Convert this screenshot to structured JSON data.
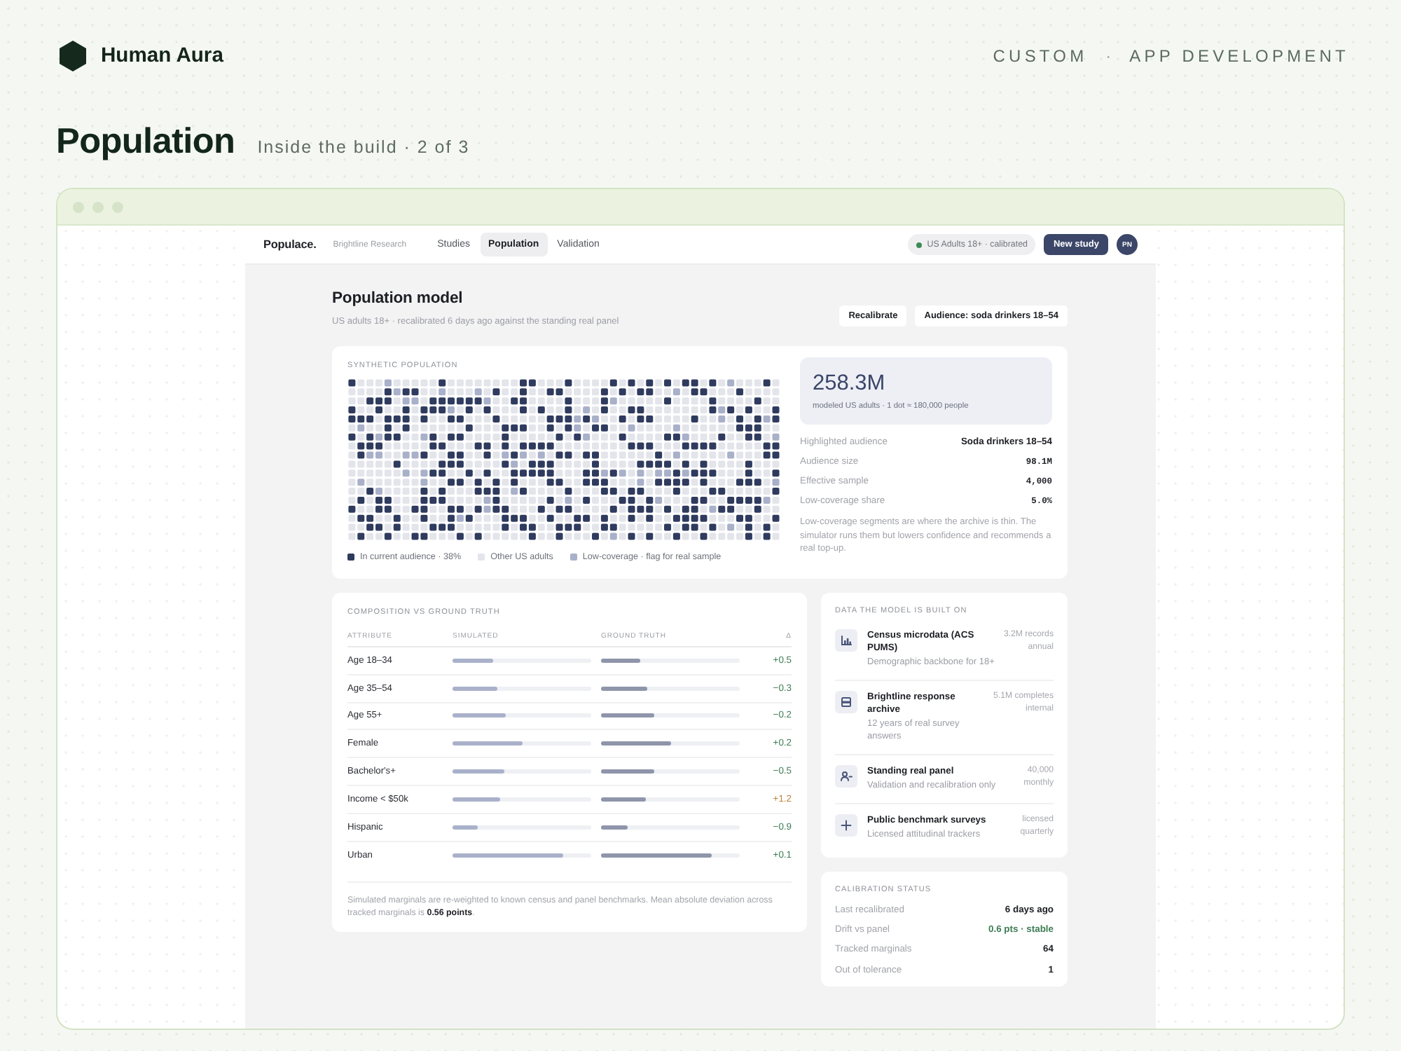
{
  "header": {
    "brand": "Human Aura",
    "links": [
      {
        "label": "CUSTOM"
      },
      {
        "label": "APP DEVELOPMENT"
      }
    ],
    "separator": "·"
  },
  "page": {
    "title": "Population",
    "subtitle": "Inside the build · 2 of 3"
  },
  "app": {
    "brand": "Populace.",
    "organization": "Brightline Research",
    "tabs": [
      {
        "label": "Studies",
        "selected": false
      },
      {
        "label": "Population",
        "selected": true
      },
      {
        "label": "Validation",
        "selected": false
      }
    ],
    "status_pill": "US Adults 18+ · calibrated",
    "primary_button": "New study",
    "avatar": "PN"
  },
  "model": {
    "title": "Population model",
    "subtitle": "US adults 18+ · recalibrated 6 days ago against the standing real panel",
    "buttons": [
      {
        "label": "Recalibrate"
      },
      {
        "label": "Audience: soda drinkers 18–54"
      }
    ]
  },
  "synthetic_population": {
    "heading": "SYNTHETIC POPULATION",
    "legend": [
      {
        "label": "In current audience · 38%",
        "color": "#2f3b5e"
      },
      {
        "label": "Other US adults",
        "color": "#e3e5eb"
      },
      {
        "label": "Low-coverage · flag for real sample",
        "color": "#a9b0c9"
      }
    ],
    "total": "258.3M",
    "total_caption": "modeled US adults · 1 dot ≈ 180,000 people",
    "facts": [
      {
        "label": "Highlighted audience",
        "value": "Soda drinkers 18–54",
        "kind": "text"
      },
      {
        "label": "Audience size",
        "value": "98.1M",
        "kind": "number"
      },
      {
        "label": "Effective sample",
        "value": "4,000",
        "kind": "number"
      },
      {
        "label": "Low-coverage share",
        "value": "5.0%",
        "kind": "number"
      }
    ],
    "note": "Low-coverage segments are where the archive is thin. The simulator runs them but lowers confidence and recommends a real top-up."
  },
  "composition": {
    "heading": "COMPOSITION VS GROUND TRUTH",
    "columns": [
      "ATTRIBUTE",
      "SIMULATED",
      "GROUND TRUTH",
      "Δ"
    ],
    "rows": [
      {
        "attribute": "Age 18–34",
        "simulated": {
          "level": 0.29
        },
        "ground_truth": {
          "level": 0.28
        },
        "delta": "+0.5",
        "out_of_tolerance": false
      },
      {
        "attribute": "Age 35–54",
        "simulated": {
          "level": 0.32
        },
        "ground_truth": {
          "level": 0.33
        },
        "delta": "−0.3",
        "out_of_tolerance": false
      },
      {
        "attribute": "Age 55+",
        "simulated": {
          "level": 0.38
        },
        "ground_truth": {
          "level": 0.38
        },
        "delta": "−0.2",
        "out_of_tolerance": false
      },
      {
        "attribute": "Female",
        "simulated": {
          "level": 0.51
        },
        "ground_truth": {
          "level": 0.51
        },
        "delta": "+0.2",
        "out_of_tolerance": false
      },
      {
        "attribute": "Bachelor's+",
        "simulated": {
          "level": 0.37
        },
        "ground_truth": {
          "level": 0.38
        },
        "delta": "−0.5",
        "out_of_tolerance": false
      },
      {
        "attribute": "Income < $50k",
        "simulated": {
          "level": 0.34
        },
        "ground_truth": {
          "level": 0.32
        },
        "delta": "+1.2",
        "out_of_tolerance": true
      },
      {
        "attribute": "Hispanic",
        "simulated": {
          "level": 0.18
        },
        "ground_truth": {
          "level": 0.19
        },
        "delta": "−0.9",
        "out_of_tolerance": false
      },
      {
        "attribute": "Urban",
        "simulated": {
          "level": 0.8
        },
        "ground_truth": {
          "level": 0.8
        },
        "delta": "+0.1",
        "out_of_tolerance": false
      }
    ],
    "note": "Simulated marginals are re-weighted to known census and panel benchmarks. Mean absolute deviation across tracked marginals is **0.56 points**."
  },
  "sources": {
    "heading": "DATA THE MODEL IS BUILT ON",
    "items": [
      {
        "title": "Census microdata (ACS PUMS)",
        "description": "Demographic backbone for 18+",
        "volume": "3.2M records",
        "cadence": "annual"
      },
      {
        "title": "Brightline response archive",
        "description": "12 years of real survey answers",
        "volume": "5.1M completes",
        "cadence": "internal"
      },
      {
        "title": "Standing real panel",
        "description": "Validation and recalibration only",
        "volume": "40,000",
        "cadence": "monthly"
      },
      {
        "title": "Public benchmark surveys",
        "description": "Licensed attitudinal trackers",
        "volume": "licensed",
        "cadence": "quarterly"
      }
    ]
  },
  "calibration": {
    "heading": "CALIBRATION STATUS",
    "rows": [
      {
        "label": "Last recalibrated",
        "value": "6 days ago",
        "positive": false
      },
      {
        "label": "Drift vs panel",
        "value": "0.6 pts · stable",
        "positive": true
      },
      {
        "label": "Tracked marginals",
        "value": "64",
        "positive": false
      },
      {
        "label": "Out of tolerance",
        "value": "1",
        "positive": false
      }
    ]
  }
}
